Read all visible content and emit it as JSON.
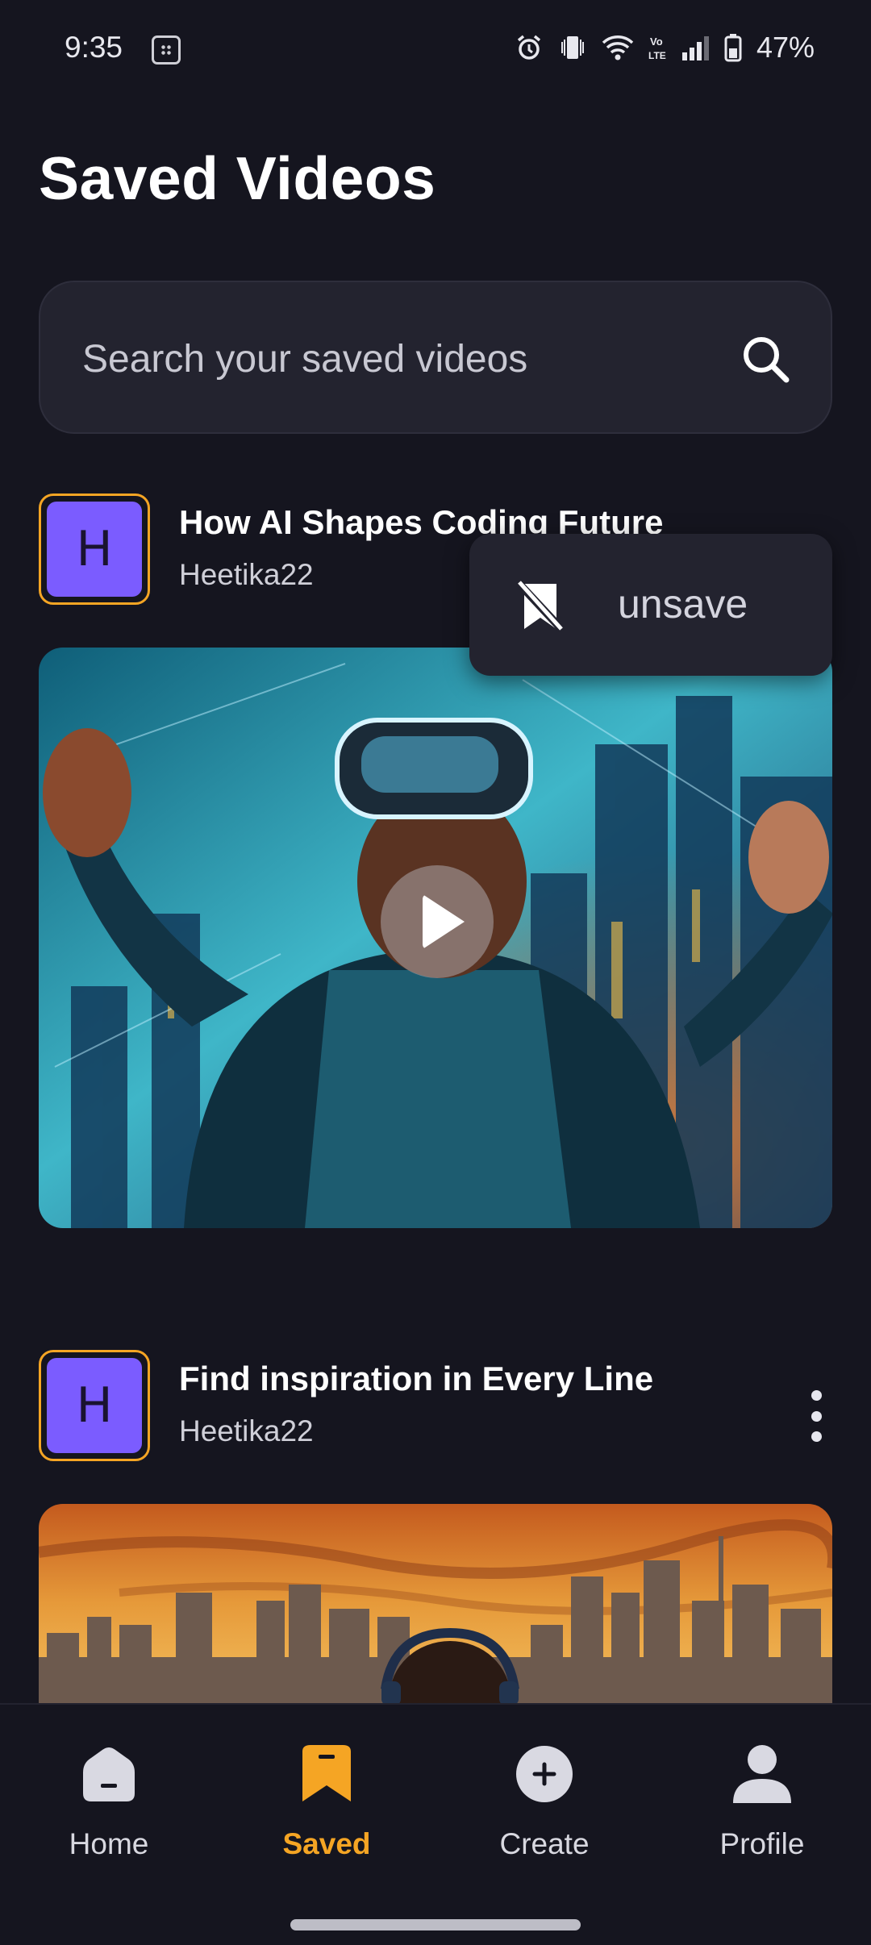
{
  "status_bar": {
    "time": "9:35",
    "battery": "47%",
    "icons": [
      "alarm-icon",
      "vibrate-icon",
      "wifi-icon",
      "volte-icon",
      "signal-icon",
      "battery-icon"
    ],
    "volte_label": "Vo LTE"
  },
  "page": {
    "title": "Saved Videos"
  },
  "search": {
    "placeholder": "Search your saved videos",
    "value": ""
  },
  "videos": [
    {
      "avatar_letter": "H",
      "title": "How AI Shapes Coding Future",
      "author": "Heetika22"
    },
    {
      "avatar_letter": "H",
      "title": "Find inspiration in Every Line",
      "author": "Heetika22"
    }
  ],
  "popup_menu": {
    "items": [
      {
        "label": "unsave",
        "icon": "bookmark-off-icon"
      }
    ]
  },
  "bottom_nav": {
    "items": [
      {
        "label": "Home",
        "icon": "home-icon"
      },
      {
        "label": "Saved",
        "icon": "bookmark-icon",
        "active": true
      },
      {
        "label": "Create",
        "icon": "plus-circle-icon"
      },
      {
        "label": "Profile",
        "icon": "user-icon"
      }
    ]
  },
  "colors": {
    "background": "#15151f",
    "surface": "#23232f",
    "accent": "#f5a524",
    "avatar": "#7b5cff"
  }
}
